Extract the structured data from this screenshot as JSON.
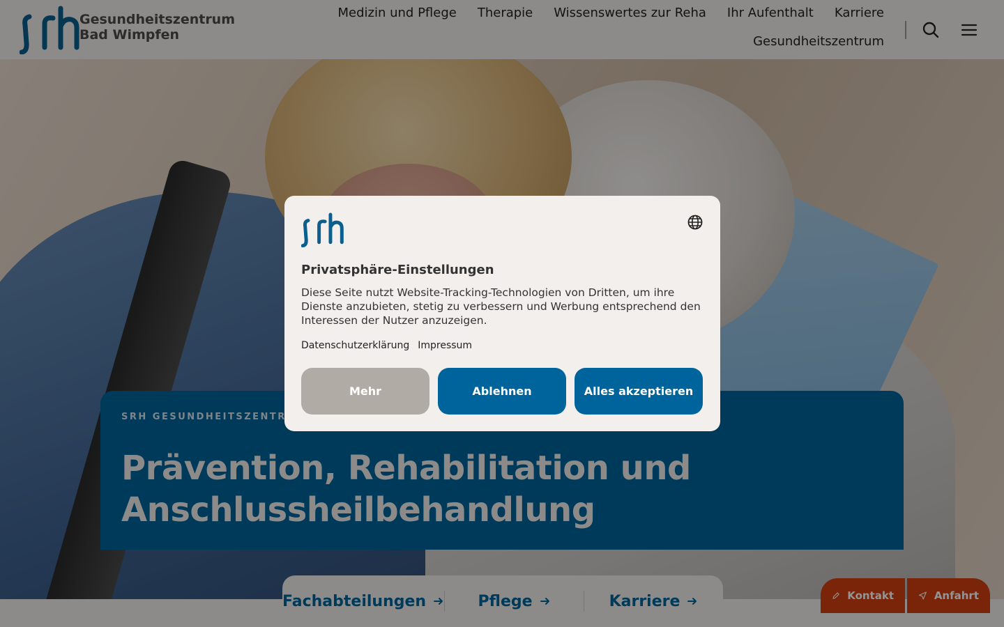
{
  "header": {
    "logo_line1": "Gesundheitszentrum",
    "logo_line2": "Bad Wimpfen",
    "nav": [
      "Medizin und Pflege",
      "Therapie",
      "Wissenswertes zur Reha",
      "Ihr Aufenthalt",
      "Karriere",
      "Gesundheitszentrum"
    ],
    "search_icon": "search-icon",
    "menu_icon": "hamburger-menu-icon"
  },
  "hero": {
    "eyebrow": "SRH Gesundheitszentrum",
    "headline_line1": "Prävention, Rehabilitation und",
    "headline_line2": "Anschlussheilbehandlung"
  },
  "quick_links": [
    "Fachabteilungen",
    "Pflege",
    "Karriere"
  ],
  "floating": {
    "kontakt": "Kontakt",
    "anfahrt": "Anfahrt"
  },
  "consent": {
    "title": "Privatsphäre-Einstellungen",
    "body": "Diese Seite nutzt Website-Tracking-Technologien von Dritten, um ihre Dienste anzubieten, stetig zu verbessern und Werbung entsprechend den Interessen der Nutzer anzuzeigen.",
    "link_privacy": "Datenschutzerklärung",
    "link_imprint": "Impressum",
    "btn_more": "Mehr",
    "btn_decline": "Ablehnen",
    "btn_accept": "Alles akzeptieren",
    "globe_icon": "globe-icon"
  },
  "colors": {
    "brand_blue": "#00649c",
    "accent_orange": "#d23f10",
    "background": "#f2efec"
  }
}
